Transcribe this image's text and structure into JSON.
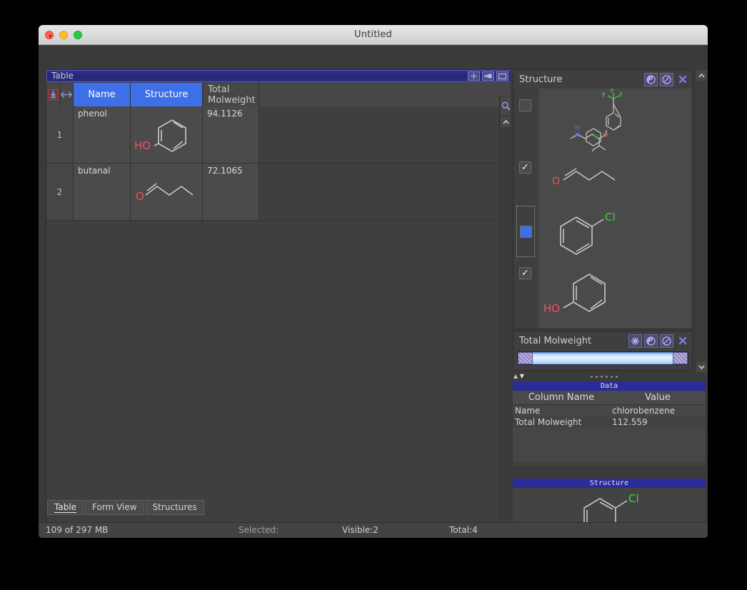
{
  "window": {
    "title": "Untitled",
    "traffic_lights": [
      "close",
      "minimize",
      "zoom"
    ]
  },
  "table_pane": {
    "title": "Table",
    "title_buttons": [
      {
        "name": "add-button",
        "glyph": "✚"
      },
      {
        "name": "wrench-button",
        "glyph": "✂"
      },
      {
        "name": "maximize-button",
        "glyph": "▭"
      }
    ],
    "row_header_icons": [
      {
        "name": "insert-row-icon",
        "glyph": "⇩"
      },
      {
        "name": "resize-columns-icon",
        "glyph": "↔"
      }
    ],
    "columns": [
      "Name",
      "Structure",
      "Total Molweight"
    ],
    "rows": [
      {
        "num": "1",
        "name": "phenol",
        "structure": "phenol",
        "molweight": "94.1126"
      },
      {
        "num": "2",
        "name": "butanal",
        "structure": "butanal",
        "molweight": "72.1065"
      }
    ],
    "scroll": {
      "search_icon": "search-icon",
      "up_arrow": "▲",
      "down_arrow": "▼"
    }
  },
  "tabs": [
    {
      "label": "Table",
      "active": true
    },
    {
      "label": "Form View",
      "active": false
    },
    {
      "label": "Structures",
      "active": false
    }
  ],
  "statusbar": {
    "memory": "109 of 297 MB",
    "selected": "Selected:",
    "visible": "Visible:2",
    "total": "Total:4"
  },
  "structure_panel": {
    "title": "Structure",
    "buttons": [
      {
        "name": "yin-yang-icon"
      },
      {
        "name": "no-entry-icon"
      },
      {
        "name": "close-icon",
        "glyph": "✖"
      }
    ],
    "items": [
      {
        "checkbox": "unchecked",
        "molecule": "fluoxetine"
      },
      {
        "checkbox": "checked",
        "molecule": "butanal"
      },
      {
        "checkbox": "selected",
        "molecule": "chlorobenzene"
      },
      {
        "checkbox": "checked",
        "molecule": "phenol"
      }
    ]
  },
  "molweight_panel": {
    "title": "Total Molweight",
    "buttons": [
      {
        "name": "asterisk-icon"
      },
      {
        "name": "yin-yang-icon"
      },
      {
        "name": "no-entry-icon"
      },
      {
        "name": "close-icon",
        "glyph": "✖"
      }
    ],
    "slider": {
      "low_handle": "min-handle",
      "high_handle": "max-handle"
    }
  },
  "data_panel": {
    "title": "Data",
    "headers": [
      "Column Name",
      "Value"
    ],
    "rows": [
      {
        "column": "Name",
        "value": "chlorobenzene"
      },
      {
        "column": "Total Molweight",
        "value": "112.559"
      }
    ]
  },
  "structure_preview": {
    "title": "Structure",
    "molecule": "chlorobenzene"
  },
  "colors": {
    "accent_blue": "#3d6fe8",
    "title_blue": "#2b2b9c",
    "oxygen_red": "#f05060",
    "chlorine_green": "#33dd33",
    "nitrogen_blue": "#5a6fd8",
    "fluorine_green": "#55cc55",
    "bond_gray": "#c8c8c8"
  }
}
